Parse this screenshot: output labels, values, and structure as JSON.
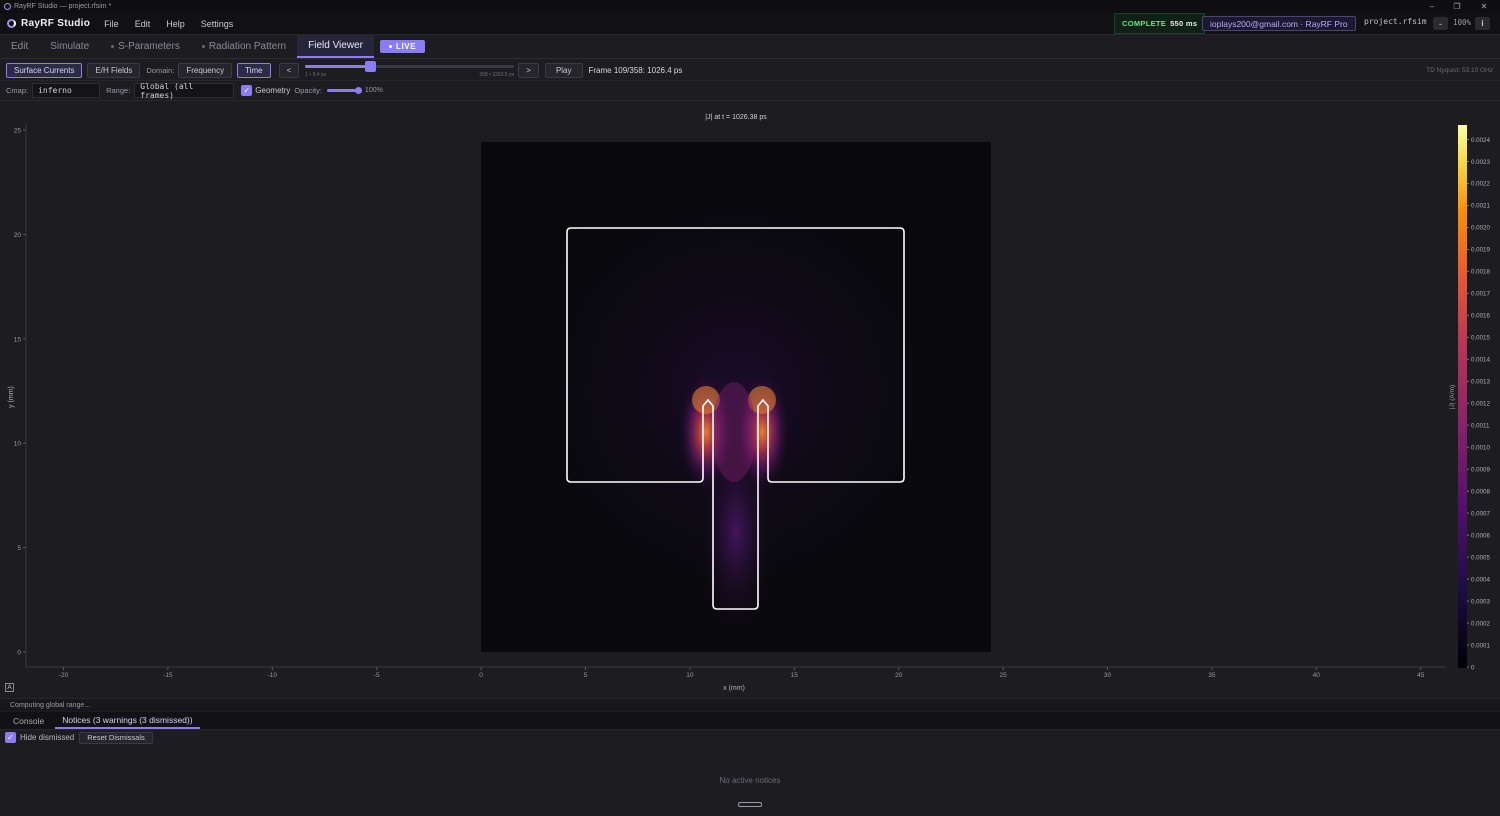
{
  "window": {
    "title": "RayRF Studio — project.rfsim *"
  },
  "menubar": {
    "brand": "RayRF Studio",
    "items": [
      "File",
      "Edit",
      "Help",
      "Settings"
    ],
    "status_label": "COMPLETE",
    "status_time": "550 ms",
    "account": "ioplays200@gmail.com · RayRF Pro",
    "project": "project.rfsim",
    "zoom_minus": "-",
    "zoom": "100%",
    "info": "i"
  },
  "tabs": [
    {
      "label": "Edit",
      "dot": false
    },
    {
      "label": "Simulate",
      "dot": false
    },
    {
      "label": "S-Parameters",
      "dot": true
    },
    {
      "label": "Radiation Pattern",
      "dot": true
    },
    {
      "label": "Field Viewer",
      "dot": false,
      "active": true
    }
  ],
  "live_badge": "LIVE",
  "toolbar1": {
    "surface_currents": "Surface Currents",
    "eh_fields": "E/H Fields",
    "domain_label": "Domain:",
    "frequency": "Frequency",
    "time": "Time",
    "prev": "<",
    "next": ">",
    "slider_value": 0.31,
    "slider_min_label": "1 • 9.4 ps",
    "slider_max_label": "358 • 3363.5 ps",
    "play": "Play",
    "frame_text": "Frame 109/358: 1026.4 ps",
    "nyquist": "TD Nyquist: 53.10 GHz"
  },
  "toolbar2": {
    "cmap_label": "Cmap:",
    "cmap_value": "inferno",
    "range_label": "Range:",
    "range_value": "Global (all frames)",
    "geometry_label": "Geometry",
    "geometry_checked": true,
    "opacity_label": "Opacity:",
    "opacity_value": 1.0,
    "opacity_text": "100%"
  },
  "plot": {
    "title": "|J| at t = 1026.38 ps",
    "xlabel": "x (mm)",
    "ylabel": "y (mm)",
    "colorbar_label": "|J| (A/m)",
    "x_ticks": [
      "-20",
      "-15",
      "-10",
      "-5",
      "0",
      "5",
      "10",
      "15",
      "20",
      "25",
      "30",
      "35",
      "40",
      "45"
    ],
    "y_ticks": [
      "0",
      "5",
      "10",
      "15",
      "20",
      "25"
    ],
    "colorbar_ticks": [
      "0",
      "0.0001",
      "0.0002",
      "0.0003",
      "0.0004",
      "0.0005",
      "0.0006",
      "0.0007",
      "0.0008",
      "0.0009",
      "0.0010",
      "0.0011",
      "0.0012",
      "0.0013",
      "0.0014",
      "0.0015",
      "0.0016",
      "0.0017",
      "0.0018",
      "0.0019",
      "0.0020",
      "0.0021",
      "0.0022",
      "0.0023",
      "0.0024"
    ],
    "autoscale_button": "A"
  },
  "status_text": "Computing global range...",
  "bottom_tabs": [
    "Console",
    "Notices (3 warnings (3 dismissed))"
  ],
  "notices": {
    "hide_dismissed": "Hide dismissed",
    "reset": "Reset Dismissals",
    "empty": "No active notices"
  },
  "colors": {
    "accent": "#8b7cf6",
    "status_green": "#6be08a",
    "background": "#1c1c21"
  }
}
